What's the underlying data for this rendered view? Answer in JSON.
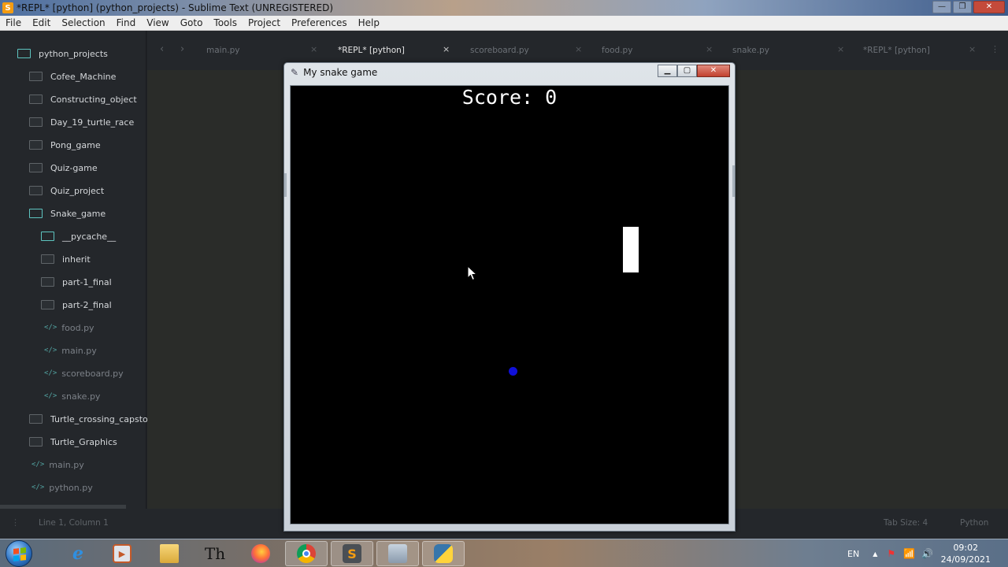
{
  "window": {
    "title": "*REPL* [python] (python_projects) - Sublime Text (UNREGISTERED)",
    "controls": {
      "minimize": "—",
      "maximize": "❐",
      "close": "✕"
    }
  },
  "menu": [
    "File",
    "Edit",
    "Selection",
    "Find",
    "View",
    "Goto",
    "Tools",
    "Project",
    "Preferences",
    "Help"
  ],
  "sidebar": {
    "root": "python_projects",
    "items": [
      "Cofee_Machine",
      "Constructing_object",
      "Day_19_turtle_race",
      "Pong_game",
      "Quiz-game",
      "Quiz_project",
      "Snake_game",
      "__pycache__",
      "inherit",
      "part-1_final",
      "part-2_final",
      "food.py",
      "main.py",
      "scoreboard.py",
      "snake.py",
      "Turtle_crossing_capstone",
      "Turtle_Graphics",
      "main.py",
      "python.py"
    ]
  },
  "tabs": [
    "main.py",
    "*REPL* [python]",
    "scoreboard.py",
    "food.py",
    "snake.py",
    "*REPL* [python]"
  ],
  "tab_close_glyph": "×",
  "status": {
    "position": "Line 1, Column 1",
    "tab_size": "Tab Size: 4",
    "syntax": "Python"
  },
  "turtle": {
    "title": "My snake game",
    "score_text": "Score: 0",
    "controls": {
      "minimize": "▁",
      "maximize": "▢",
      "close": "✕"
    },
    "food_color": "#1010d8"
  },
  "taskbar": {
    "language": "EN",
    "time": "09:02",
    "date": "24/09/2021"
  }
}
